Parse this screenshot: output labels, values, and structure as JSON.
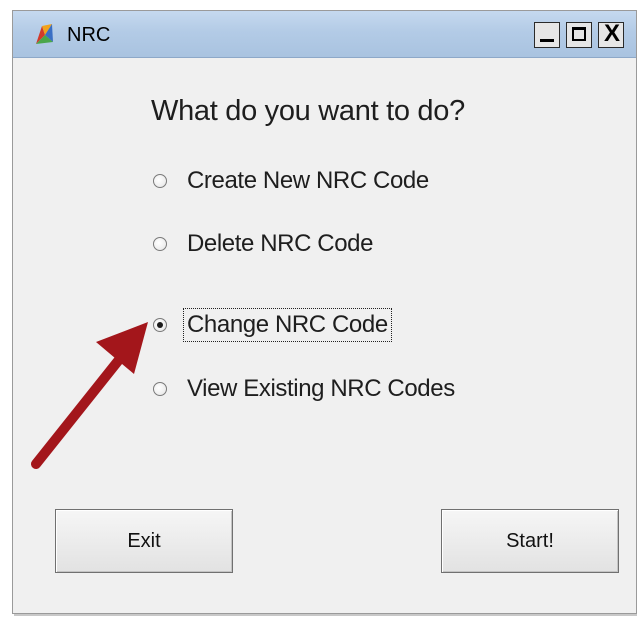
{
  "window": {
    "title": "NRC",
    "controls": {
      "minimize": "_",
      "maximize": "□",
      "close": "X"
    }
  },
  "prompt": "What do you want to do?",
  "options": [
    {
      "label": "Create New NRC Code",
      "selected": false
    },
    {
      "label": "Delete NRC Code",
      "selected": false
    },
    {
      "label": "Change NRC Code",
      "selected": true
    },
    {
      "label": "View Existing NRC Codes",
      "selected": false
    }
  ],
  "buttons": {
    "exit": "Exit",
    "start": "Start!"
  },
  "colors": {
    "annotation_arrow": "#a3161b",
    "titlebar": "#b3cbe6",
    "window_bg": "#f0f0f0"
  }
}
